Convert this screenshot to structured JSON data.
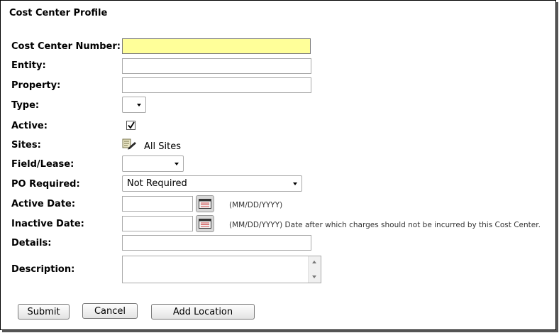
{
  "title": "Cost Center Profile",
  "fields": {
    "cost_center_number": {
      "label": "Cost Center Number:",
      "value": ""
    },
    "entity": {
      "label": "Entity:",
      "value": ""
    },
    "property": {
      "label": "Property:",
      "value": ""
    },
    "type": {
      "label": "Type:",
      "value": ""
    },
    "active": {
      "label": "Active:",
      "checked": true
    },
    "sites": {
      "label": "Sites:",
      "value": "All Sites",
      "icon": "edit-list-icon"
    },
    "field_lease": {
      "label": "Field/Lease:",
      "value": ""
    },
    "po_required": {
      "label": "PO Required:",
      "value": "Not Required"
    },
    "active_date": {
      "label": "Active Date:",
      "value": "",
      "hint": "(MM/DD/YYYY)",
      "icon": "calendar-icon"
    },
    "inactive_date": {
      "label": "Inactive Date:",
      "value": "",
      "hint": "(MM/DD/YYYY) Date after which charges should not be incurred by this Cost Center.",
      "icon": "calendar-icon"
    },
    "details": {
      "label": "Details:",
      "value": ""
    },
    "description": {
      "label": "Description:",
      "value": ""
    }
  },
  "buttons": {
    "submit": "Submit",
    "cancel": "Cancel",
    "add_location": "Add Location"
  },
  "colors": {
    "highlight": "#ffff99",
    "border": "#a9a9a9"
  }
}
